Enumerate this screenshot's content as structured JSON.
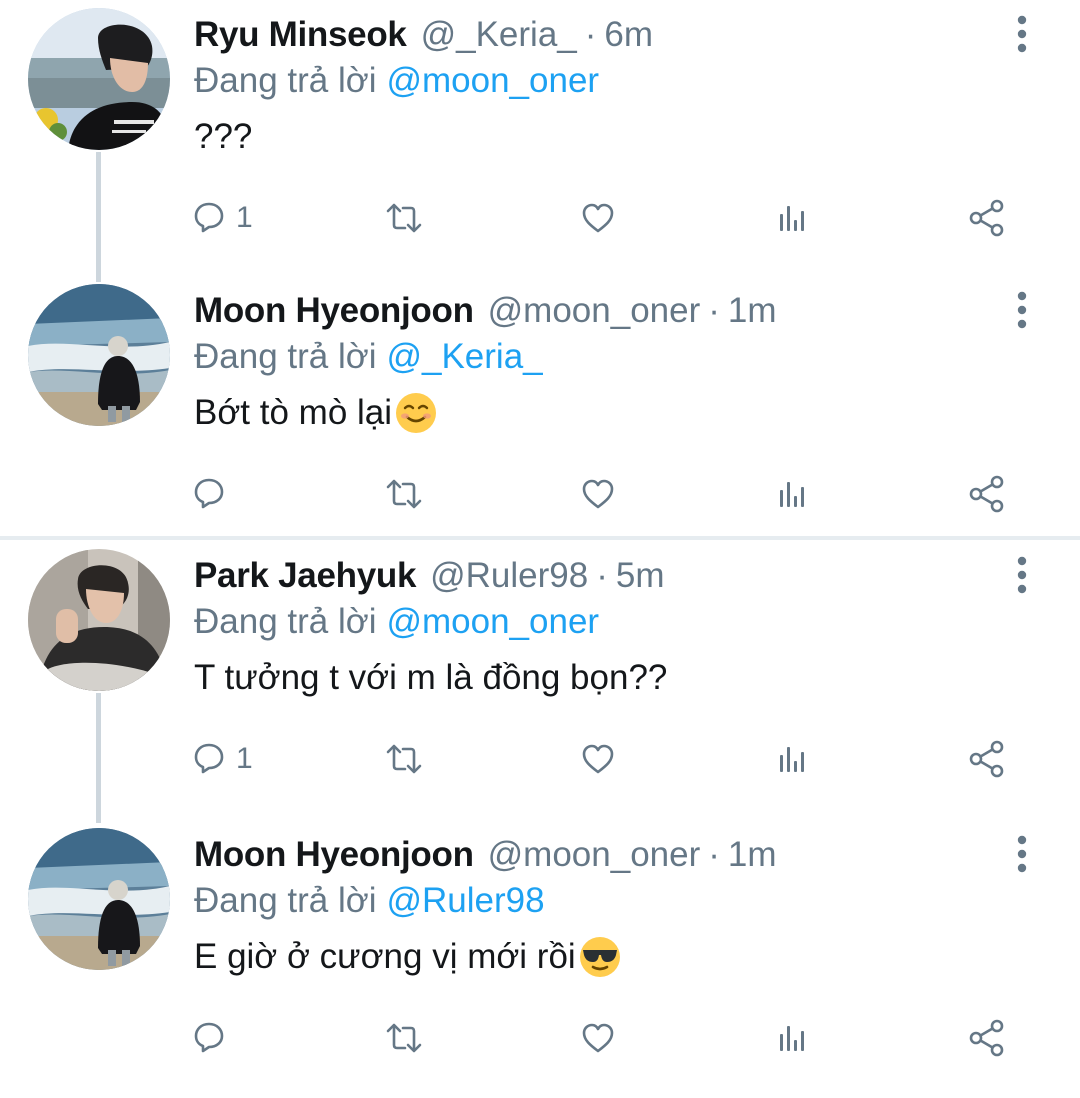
{
  "threads": [
    {
      "tweets": [
        {
          "name": "Ryu Minseok",
          "handle": "@_Keria_",
          "separator": "·",
          "time": "6m",
          "replying_prefix": "Đang trả lời",
          "replying_to": "@moon_oner",
          "text": "???",
          "emoji": "",
          "reply_count": "1",
          "avatar": "avatar-keria"
        },
        {
          "name": "Moon Hyeonjoon",
          "handle": "@moon_oner",
          "separator": "·",
          "time": "1m",
          "replying_prefix": "Đang trả lời",
          "replying_to": "@_Keria_",
          "text": "Bớt tò mò lại",
          "emoji": "smiling-face-emoji",
          "reply_count": "",
          "avatar": "avatar-oner"
        }
      ]
    },
    {
      "tweets": [
        {
          "name": "Park Jaehyuk",
          "handle": "@Ruler98",
          "separator": "·",
          "time": "5m",
          "replying_prefix": "Đang trả lời",
          "replying_to": "@moon_oner",
          "text": "T tưởng t với m là đồng bọn??",
          "emoji": "",
          "reply_count": "1",
          "avatar": "avatar-ruler"
        },
        {
          "name": "Moon Hyeonjoon",
          "handle": "@moon_oner",
          "separator": "·",
          "time": "1m",
          "replying_prefix": "Đang trả lời",
          "replying_to": "@Ruler98",
          "text": "E giờ ở cương vị mới rồi",
          "emoji": "sunglasses-emoji",
          "reply_count": "",
          "avatar": "avatar-oner"
        }
      ]
    }
  ],
  "icons": {
    "reply": "reply-icon",
    "retweet": "retweet-icon",
    "like": "heart-icon",
    "stats": "stats-icon",
    "share": "share-icon",
    "more": "more-vertical-icon"
  },
  "colors": {
    "text": "#14171a",
    "muted": "#657786",
    "mention": "#1da1f2",
    "icon": "#657786",
    "thread_line": "#cdd6dd",
    "divider": "#e6ecf0"
  }
}
